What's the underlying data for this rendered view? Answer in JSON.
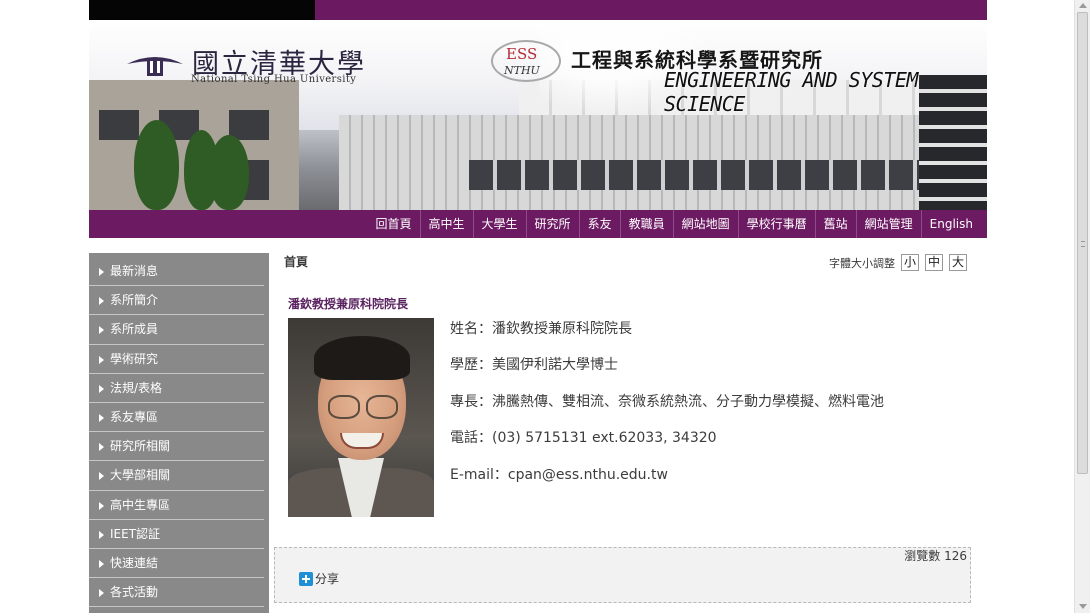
{
  "header": {
    "university_name": "國立清華大學",
    "university_name_en": "National Tsing Hua University",
    "ess_logo_top": "ESS",
    "ess_logo_bottom": "NTHU",
    "department_zh": "工程與系統科學系暨研究所",
    "department_en": "ENGINEERING AND SYSTEM SCIENCE"
  },
  "nav": {
    "items": [
      "回首頁",
      "高中生",
      "大學生",
      "研究所",
      "系友",
      "教職員",
      "網站地圖",
      "學校行事曆",
      "舊站",
      "網站管理",
      "English"
    ]
  },
  "sidebar": {
    "items": [
      "最新消息",
      "系所簡介",
      "系所成員",
      "學術研究",
      "法規/表格",
      "系友專區",
      "研究所相關",
      "大學部相關",
      "高中生專區",
      "IEET認証",
      "快速連結",
      "各式活動"
    ]
  },
  "content": {
    "breadcrumb": "首頁",
    "font_size_label": "字體大小調整",
    "font_size_small": "小",
    "font_size_medium": "中",
    "font_size_large": "大",
    "title": "潘欽教授兼原科院院長",
    "info": [
      "姓名：潘欽教授兼原科院院長",
      "學歷：美國伊利諾大學博士",
      "專長：沸騰熱傳、雙相流、奈微系統熱流、分子動力學模擬、燃料電池",
      "電話：(03) 5715131 ext.62033, 34320",
      "E-mail：cpan@ess.nthu.edu.tw"
    ],
    "views": "瀏覽數 126",
    "share_label": "分享"
  },
  "colors": {
    "brand_purple": "#6c1a62",
    "sidebar_gray": "#898989",
    "title_purple": "#5b2461"
  }
}
